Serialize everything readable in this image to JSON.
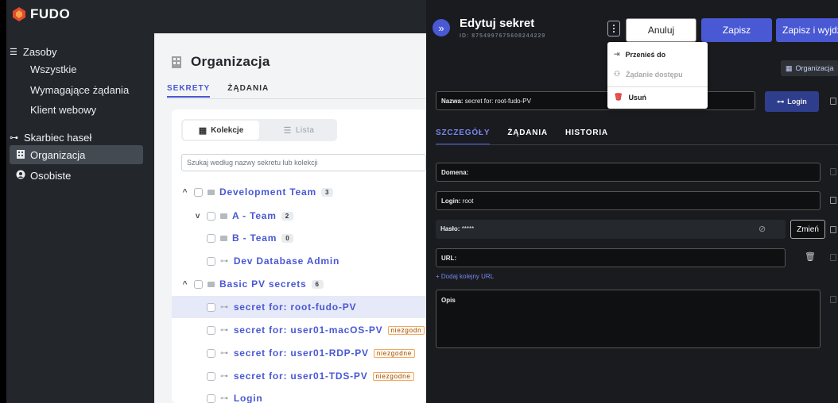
{
  "sidebar": {
    "logo": "FUDO",
    "resources": {
      "heading": "Zasoby",
      "items": [
        "Wszystkie",
        "Wymagające żądania",
        "Klient webowy"
      ]
    },
    "vault": {
      "heading": "Skarbiec haseł",
      "items": [
        {
          "label": "Organizacja",
          "icon": "building-icon",
          "active": true
        },
        {
          "label": "Osobiste",
          "icon": "user-icon",
          "active": false
        }
      ]
    }
  },
  "main": {
    "title": "Organizacja",
    "tabs": [
      {
        "label": "SEKRETY",
        "active": true
      },
      {
        "label": "ŻĄDANIA",
        "active": false
      }
    ],
    "view_toggle": {
      "collections": "Kolekcje",
      "list": "Lista"
    },
    "search_placeholder": "Szukaj według nazwy sekretu lub kolekcji",
    "tree": [
      {
        "label": "Development Team",
        "count": "3",
        "type": "folder",
        "chevron": "^"
      },
      {
        "label": "A - Team",
        "count": "2",
        "type": "folder",
        "chevron": "v"
      },
      {
        "label": "B - Team",
        "count": "0",
        "type": "folder",
        "chevron": ""
      },
      {
        "label": "Dev Database Admin",
        "type": "secret"
      },
      {
        "label": "Basic PV secrets",
        "count": "6",
        "type": "folder",
        "chevron": "^"
      },
      {
        "label": "secret for: root-fudo-PV",
        "type": "secret",
        "selected": true
      },
      {
        "label": "secret for: user01-macOS-PV",
        "type": "secret",
        "badge": "niezgodn"
      },
      {
        "label": "secret for: user01-RDP-PV",
        "type": "secret",
        "badge": "niezgodne"
      },
      {
        "label": "secret for: user01-TDS-PV",
        "type": "secret",
        "badge": "niezgodne"
      },
      {
        "label": "Login",
        "type": "secret"
      }
    ]
  },
  "drawer": {
    "title": "Edytuj sekret",
    "id": "ID: 8754997675608244229",
    "buttons": {
      "cancel": "Anuluj",
      "save": "Zapisz",
      "save_exit": "Zapisz i wyjdź"
    },
    "menu": [
      {
        "label": "Przenieś do",
        "icon": "move-icon",
        "disabled": false
      },
      {
        "label": "Żądanie dostępu",
        "icon": "request-icon",
        "disabled": true
      },
      {
        "label": "Usuń",
        "icon": "trash-icon",
        "disabled": false
      }
    ],
    "org_badge": "Organizacja",
    "name_label": "Nazwa:",
    "name_value": "secret for: root-fudo-PV",
    "login_button": "Login",
    "tabs": [
      {
        "label": "SZCZEGÓŁY",
        "active": true
      },
      {
        "label": "ŻĄDANIA",
        "active": false
      },
      {
        "label": "HISTORIA",
        "active": false
      }
    ],
    "domain_label": "Domena:",
    "login_label": "Login:",
    "login_value": "root",
    "password_label": "Hasło:",
    "password_value": "*****",
    "change_button": "Zmień",
    "url_label": "URL:",
    "add_url": "+ Dodaj kolejny URL",
    "description_label": "Opis"
  }
}
